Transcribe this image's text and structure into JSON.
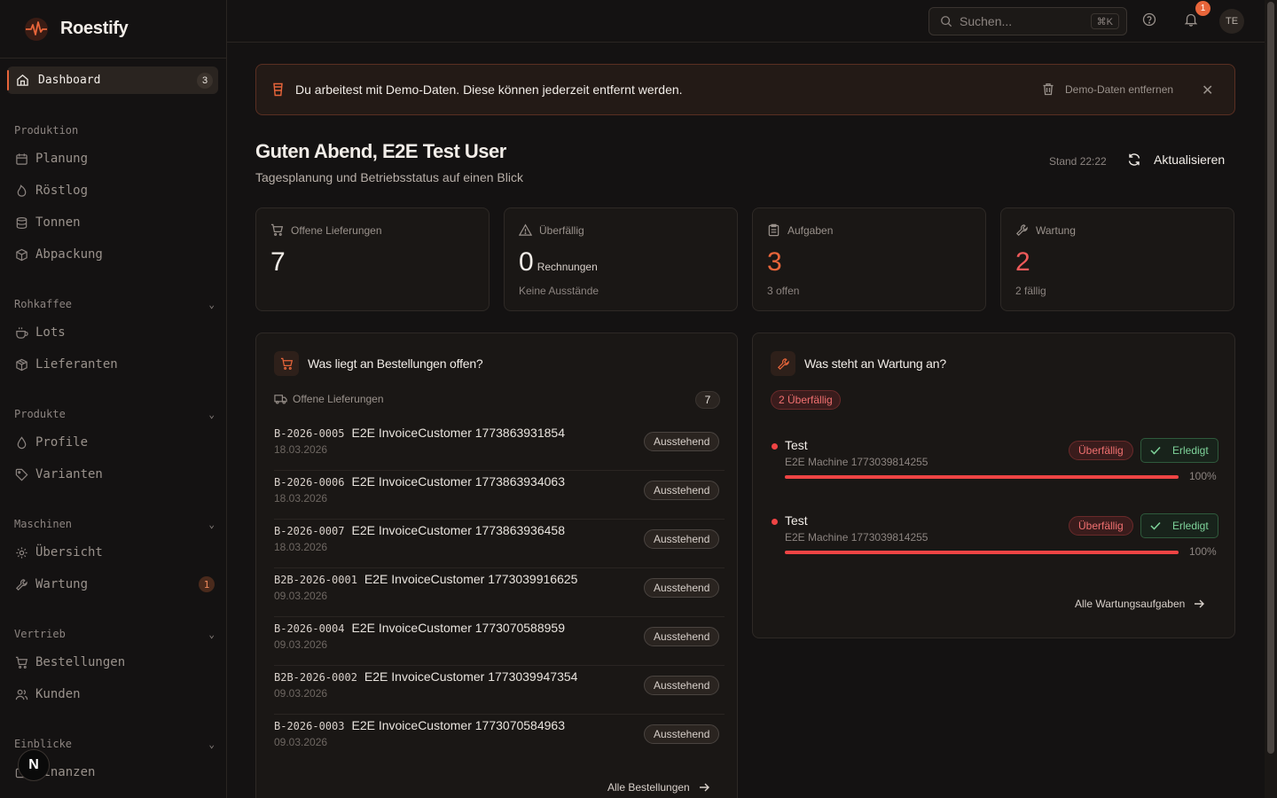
{
  "app": {
    "name": "Roestify"
  },
  "sidebar": {
    "active": {
      "label": "Dashboard",
      "badge": "3"
    },
    "sections": [
      {
        "title": "Produktion",
        "items": [
          {
            "label": "Planung"
          },
          {
            "label": "Röstlog"
          },
          {
            "label": "Tonnen"
          },
          {
            "label": "Abpackung"
          }
        ]
      },
      {
        "title": "Rohkaffee",
        "items": [
          {
            "label": "Lots"
          },
          {
            "label": "Lieferanten"
          }
        ]
      },
      {
        "title": "Produkte",
        "items": [
          {
            "label": "Profile"
          },
          {
            "label": "Varianten"
          }
        ]
      },
      {
        "title": "Maschinen",
        "items": [
          {
            "label": "Übersicht"
          },
          {
            "label": "Wartung",
            "badge": "1"
          }
        ]
      },
      {
        "title": "Vertrieb",
        "items": [
          {
            "label": "Bestellungen"
          },
          {
            "label": "Kunden"
          }
        ]
      },
      {
        "title": "Einblicke",
        "items": [
          {
            "label": "Finanzen"
          }
        ]
      }
    ],
    "fab_label": "N"
  },
  "topbar": {
    "search_placeholder": "Suchen...",
    "search_shortcut": "⌘K",
    "notification_count": "1",
    "avatar_initials": "TE"
  },
  "banner": {
    "text": "Du arbeitest mit Demo-Daten. Diese können jederzeit entfernt werden.",
    "remove_label": "Demo-Daten entfernen"
  },
  "header": {
    "greeting": "Guten Abend, E2E Test User",
    "subtitle": "Tagesplanung und Betriebsstatus auf einen Blick",
    "stand": "Stand 22:22",
    "refresh_label": "Aktualisieren"
  },
  "stats": [
    {
      "label": "Offene Lieferungen",
      "value": "7",
      "unit": "",
      "footer": ""
    },
    {
      "label": "Überfällig",
      "value": "0",
      "unit": "Rechnungen",
      "footer": "Keine Ausstände"
    },
    {
      "label": "Aufgaben",
      "value": "3",
      "unit": "",
      "footer": "3 offen"
    },
    {
      "label": "Wartung",
      "value": "2",
      "unit": "",
      "footer": "2 fällig"
    }
  ],
  "orders": {
    "title": "Was liegt an Bestellungen offen?",
    "subtitle": "Offene Lieferungen",
    "count": "7",
    "status_label": "Ausstehend",
    "rows": [
      {
        "code": "B-2026-0005",
        "customer": "E2E InvoiceCustomer 1773863931854",
        "date": "18.03.2026"
      },
      {
        "code": "B-2026-0006",
        "customer": "E2E InvoiceCustomer 1773863934063",
        "date": "18.03.2026"
      },
      {
        "code": "B-2026-0007",
        "customer": "E2E InvoiceCustomer 1773863936458",
        "date": "18.03.2026"
      },
      {
        "code": "B2B-2026-0001",
        "customer": "E2E InvoiceCustomer 1773039916625",
        "date": "09.03.2026"
      },
      {
        "code": "B-2026-0004",
        "customer": "E2E InvoiceCustomer 1773070588959",
        "date": "09.03.2026"
      },
      {
        "code": "B2B-2026-0002",
        "customer": "E2E InvoiceCustomer 1773039947354",
        "date": "09.03.2026"
      },
      {
        "code": "B-2026-0003",
        "customer": "E2E InvoiceCustomer 1773070584963",
        "date": "09.03.2026"
      }
    ],
    "all_link": "Alle Bestellungen"
  },
  "maintenance": {
    "title": "Was steht an Wartung an?",
    "overdue_summary": "2 Überfällig",
    "items": [
      {
        "title": "Test",
        "machine": "E2E Machine 1773039814255",
        "status": "Überfällig",
        "action": "Erledigt",
        "progress": "100%"
      },
      {
        "title": "Test",
        "machine": "E2E Machine 1773039814255",
        "status": "Überfällig",
        "action": "Erledigt",
        "progress": "100%"
      }
    ],
    "all_link": "Alle Wartungsaufgaben"
  }
}
